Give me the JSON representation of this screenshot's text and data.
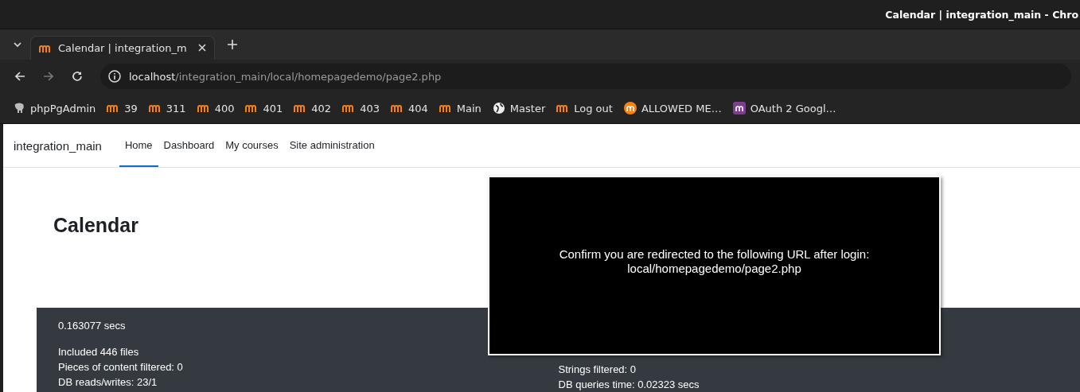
{
  "window": {
    "title": "Calendar | integration_main - Chro"
  },
  "tabs": [
    {
      "label": "Calendar | integration_m",
      "selected": true
    }
  ],
  "address": {
    "host": "localhost",
    "path": "/integration_main/local/homepagedemo/page2.php"
  },
  "bookmarks": [
    {
      "label": "phpPgAdmin",
      "kind": "elephant"
    },
    {
      "label": "39",
      "kind": "moodle"
    },
    {
      "label": "311",
      "kind": "moodle"
    },
    {
      "label": "400",
      "kind": "moodle"
    },
    {
      "label": "401",
      "kind": "moodle"
    },
    {
      "label": "402",
      "kind": "moodle"
    },
    {
      "label": "403",
      "kind": "moodle"
    },
    {
      "label": "404",
      "kind": "moodle"
    },
    {
      "label": "Main",
      "kind": "moodle"
    },
    {
      "label": "Master",
      "kind": "globe"
    },
    {
      "label": "Log out",
      "kind": "moodle"
    },
    {
      "label": "ALLOWED ME…",
      "kind": "circle"
    },
    {
      "label": "OAuth 2 Googl…",
      "kind": "square"
    }
  ],
  "site": {
    "name": "integration_main",
    "nav": [
      {
        "label": "Home",
        "selected": true
      },
      {
        "label": "Dashboard",
        "selected": false
      },
      {
        "label": "My courses",
        "selected": false
      },
      {
        "label": "Site administration",
        "selected": false
      }
    ]
  },
  "heading": "Calendar",
  "footer": {
    "time": "0.163077 secs",
    "left": [
      "Included 446 files",
      "Pieces of content filtered: 0",
      "DB reads/writes: 23/1"
    ],
    "right": [
      "Strings filtered: 0",
      "DB queries time: 0.02323 secs"
    ]
  },
  "modal": {
    "lines": [
      "Confirm you are redirected to the following URL after login:",
      "local/homepagedemo/page2.php"
    ]
  }
}
